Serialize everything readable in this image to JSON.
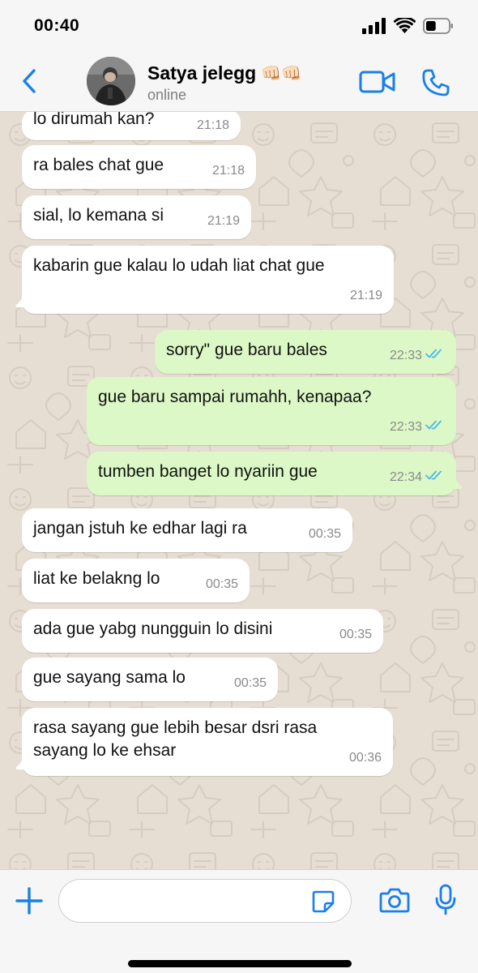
{
  "status_bar": {
    "time": "00:40",
    "battery_level": 0.45
  },
  "header": {
    "contact_name": "Satya jelegg",
    "contact_emoji": "👊🏻👊🏻",
    "contact_status": "online",
    "icons": [
      "chevron-left-icon",
      "video-camera-icon",
      "phone-icon"
    ],
    "accent_color": "#1A7FE8"
  },
  "messages": [
    {
      "dir": "in",
      "text": "lo dirumah kan?",
      "time": "21:18"
    },
    {
      "dir": "in",
      "text": "ra bales chat gue",
      "time": "21:18"
    },
    {
      "dir": "in",
      "text": "sial, lo kemana si",
      "time": "21:19"
    },
    {
      "dir": "in",
      "text": "kabarin gue kalau lo udah liat chat gue",
      "time": "21:19"
    },
    {
      "dir": "out",
      "text": "sorry\" gue baru bales",
      "time": "22:33",
      "read": true
    },
    {
      "dir": "out",
      "text": "gue baru sampai rumahh, kenapaa?",
      "time": "22:33",
      "read": true
    },
    {
      "dir": "out",
      "text": "tumben banget lo nyariin gue",
      "time": "22:34",
      "read": true
    },
    {
      "dir": "in",
      "text": "jangan jstuh ke edhar lagi ra",
      "time": "00:35"
    },
    {
      "dir": "in",
      "text": "liat ke belakng lo",
      "time": "00:35"
    },
    {
      "dir": "in",
      "text": "ada gue yabg nungguin lo disini",
      "time": "00:35"
    },
    {
      "dir": "in",
      "text": "gue sayang sama lo",
      "time": "00:35"
    },
    {
      "dir": "in",
      "text": "rasa sayang gue lebih besar dsri rasa\nsayang lo ke ehsar",
      "time": "00:36"
    }
  ],
  "colors": {
    "incoming_bubble": "#FFFFFF",
    "outgoing_bubble": "#DCF8C6",
    "read_ticks": "#4FB6EC",
    "chat_background": "#E6DED3"
  },
  "input": {
    "placeholder": "",
    "icons": [
      "plus-icon",
      "sticker-icon",
      "camera-icon",
      "microphone-icon"
    ]
  }
}
